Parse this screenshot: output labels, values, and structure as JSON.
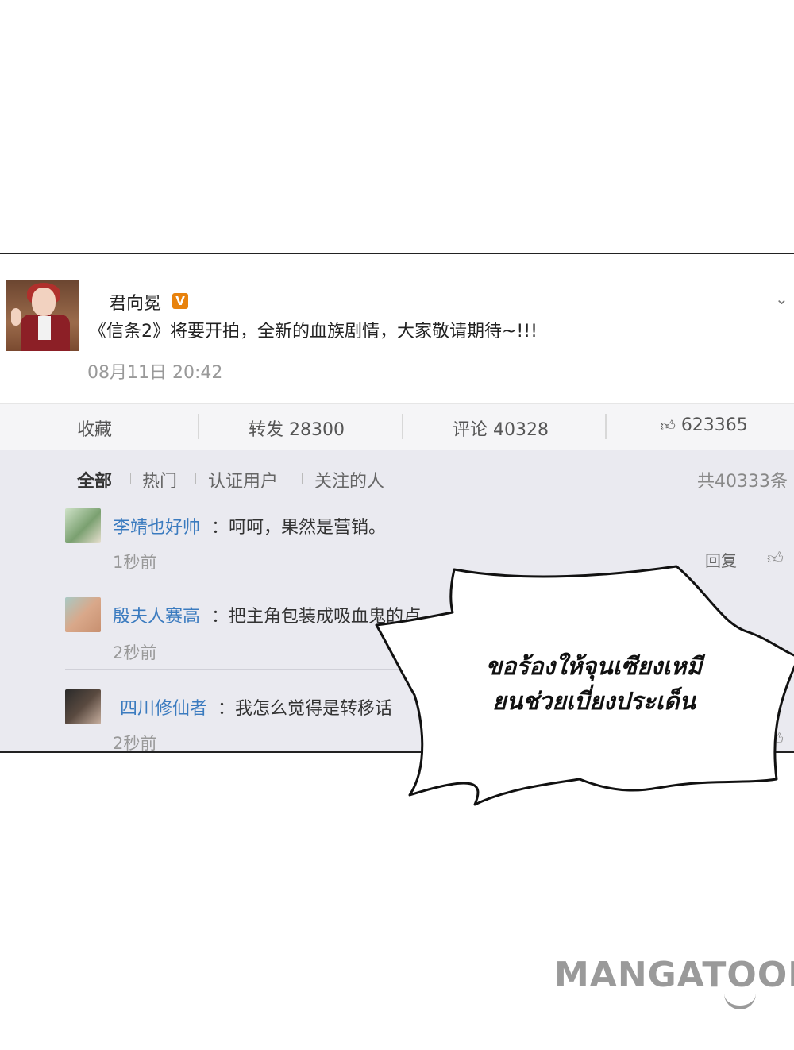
{
  "post": {
    "username": "君向冕",
    "badge": "V",
    "text": "《信条2》将要开拍，全新的血族剧情，大家敬请期待~!!!",
    "time": "08月11日 20:42"
  },
  "actions": {
    "favorite": "收藏",
    "repost": "转发 28300",
    "comment": "评论 40328",
    "like": "623365"
  },
  "filters": {
    "all": "全部",
    "hot": "热门",
    "verified": "认证用户",
    "following": "关注的人",
    "total": "共40333条"
  },
  "comments": [
    {
      "name": "李靖也好帅",
      "text": "：呵呵，果然是营销。",
      "time": "1秒前",
      "reply": "回复"
    },
    {
      "name": "殷夫人赛高",
      "text": "：把主角包装成吸血鬼的卢",
      "time": "2秒前"
    },
    {
      "name": "四川修仙者",
      "text": "：我怎么觉得是转移话",
      "time": "2秒前"
    }
  ],
  "speech_bubble": {
    "line1": "ขอร้องให้จุนเซียงเหมี",
    "line2": "ยนช่วยเบี่ยงประเด็น"
  },
  "watermark": "MANGATOON",
  "colors": {
    "link": "#3b7bbf",
    "badge": "#e8820c",
    "comment_bg": "#eaeaf0"
  }
}
